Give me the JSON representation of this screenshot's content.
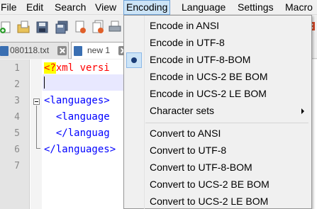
{
  "menubar": {
    "items": [
      "File",
      "Edit",
      "Search",
      "View",
      "Encoding",
      "Language",
      "Settings",
      "Macro"
    ],
    "active_index": 4
  },
  "toolbar": {
    "icons": [
      "new-file-icon",
      "open-file-icon",
      "save-icon",
      "save-all-icon",
      "close-icon",
      "close-all-icon",
      "print-icon"
    ]
  },
  "tabs": [
    {
      "label": "080118.txt",
      "active": false
    },
    {
      "label": "new 1",
      "active": true
    }
  ],
  "editor": {
    "line_numbers": [
      "1",
      "2",
      "3",
      "4",
      "5",
      "6",
      "7"
    ],
    "lines": [
      {
        "pi_open": "<?",
        "text": "xml versi"
      },
      {
        "text": ""
      },
      {
        "text": "<languages>"
      },
      {
        "text": "  <language"
      },
      {
        "text": "  </languag"
      },
      {
        "text": "</languages>"
      },
      {
        "text": ""
      }
    ]
  },
  "encoding_menu": {
    "items": [
      {
        "label": "Encode in ANSI",
        "checked": false,
        "submenu": false
      },
      {
        "label": "Encode in UTF-8",
        "checked": false,
        "submenu": false
      },
      {
        "label": "Encode in UTF-8-BOM",
        "checked": true,
        "submenu": false
      },
      {
        "label": "Encode in UCS-2 BE BOM",
        "checked": false,
        "submenu": false
      },
      {
        "label": "Encode in UCS-2 LE BOM",
        "checked": false,
        "submenu": false
      },
      {
        "label": "Character sets",
        "checked": false,
        "submenu": true
      },
      {
        "separator": true
      },
      {
        "label": "Convert to ANSI",
        "checked": false,
        "submenu": false
      },
      {
        "label": "Convert to UTF-8",
        "checked": false,
        "submenu": false
      },
      {
        "label": "Convert to UTF-8-BOM",
        "checked": false,
        "submenu": false
      },
      {
        "label": "Convert to UCS-2 BE BOM",
        "checked": false,
        "submenu": false
      },
      {
        "label": "Convert to UCS-2 LE BOM",
        "checked": false,
        "submenu": false
      }
    ]
  },
  "colors": {
    "tag_blue": "#0000ff",
    "pi_red": "#ff0000",
    "pi_highlight": "#ffff00",
    "menu_highlight": "#cce4f7"
  }
}
